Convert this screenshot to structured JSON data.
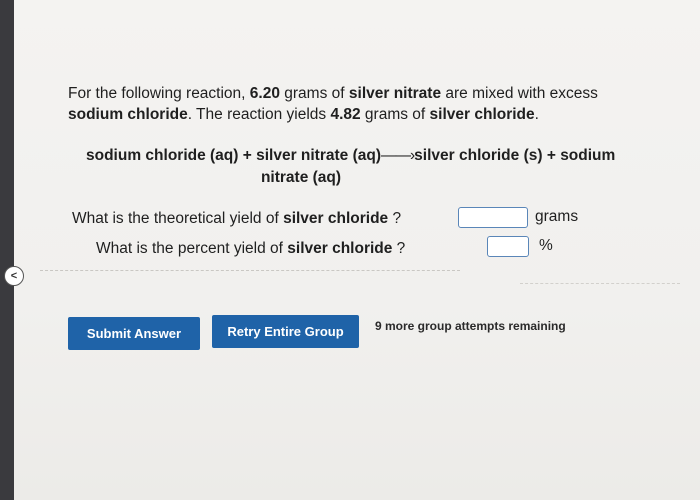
{
  "question": {
    "p1": "For the following reaction, ",
    "mass1": "6.20",
    "p2": " grams of ",
    "reactant1": "silver nitrate",
    "p3": " are mixed with excess ",
    "reactant2": "sodium chloride",
    "p4": ". The reaction yields ",
    "mass2": "4.82",
    "p5": " grams of ",
    "product": "silver chloride",
    "p6": "."
  },
  "equation": {
    "line1_left": "sodium chloride (aq) + silver nitrate (aq)",
    "arrow": "——›",
    "line1_right": "silver chloride (s) + sodium",
    "line2": "nitrate (aq)"
  },
  "row1": {
    "prefix": "What is the theoretical yield of ",
    "bold": "silver chloride",
    "suffix": " ?",
    "unit": "grams",
    "value": ""
  },
  "row2": {
    "prefix": "What is the percent yield of ",
    "bold": "silver chloride",
    "suffix": " ?",
    "unit": "%",
    "value": ""
  },
  "buttons": {
    "submit": "Submit Answer",
    "retry": "Retry Entire Group"
  },
  "attempts": "9 more group attempts remaining",
  "collapse_icon": "chevron-left-icon"
}
